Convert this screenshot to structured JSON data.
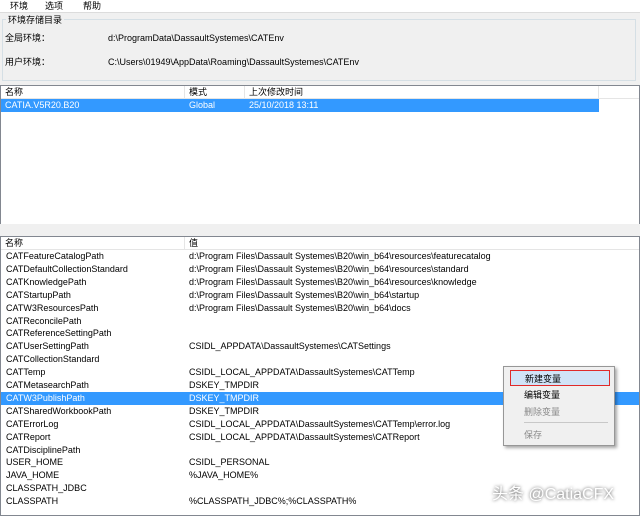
{
  "menubar": {
    "items": [
      "环境",
      "选项",
      "帮助"
    ]
  },
  "env_dir": {
    "title": "环境存储目录",
    "global_label": "全局环境：",
    "global_path": "d:\\ProgramData\\DassaultSystemes\\CATEnv",
    "user_label": "用户环境：",
    "user_path": "C:\\Users\\01949\\AppData\\Roaming\\DassaultSystemes\\CATEnv"
  },
  "env_table": {
    "headers": [
      "名称",
      "模式",
      "上次修改时间"
    ],
    "rows": [
      {
        "name": "CATIA.V5R20.B20",
        "mode": "Global",
        "modified": "25/10/2018  13:11"
      }
    ]
  },
  "var_table": {
    "headers": [
      "名称",
      "值"
    ],
    "rows": [
      {
        "name": "CATFeatureCatalogPath",
        "value": "d:\\Program Files\\Dassault Systemes\\B20\\win_b64\\resources\\featurecatalog"
      },
      {
        "name": "CATDefaultCollectionStandard",
        "value": "d:\\Program Files\\Dassault Systemes\\B20\\win_b64\\resources\\standard"
      },
      {
        "name": "CATKnowledgePath",
        "value": "d:\\Program Files\\Dassault Systemes\\B20\\win_b64\\resources\\knowledge"
      },
      {
        "name": "CATStartupPath",
        "value": "d:\\Program Files\\Dassault Systemes\\B20\\win_b64\\startup"
      },
      {
        "name": "CATW3ResourcesPath",
        "value": "d:\\Program Files\\Dassault Systemes\\B20\\win_b64\\docs"
      },
      {
        "name": "CATReconcilePath",
        "value": ""
      },
      {
        "name": "CATReferenceSettingPath",
        "value": ""
      },
      {
        "name": "CATUserSettingPath",
        "value": "CSIDL_APPDATA\\DassaultSystemes\\CATSettings"
      },
      {
        "name": "CATCollectionStandard",
        "value": ""
      },
      {
        "name": "CATTemp",
        "value": "CSIDL_LOCAL_APPDATA\\DassaultSystemes\\CATTemp"
      },
      {
        "name": "CATMetasearchPath",
        "value": "DSKEY_TMPDIR"
      },
      {
        "name": "CATW3PublishPath",
        "value": "DSKEY_TMPDIR"
      },
      {
        "name": "CATSharedWorkbookPath",
        "value": "DSKEY_TMPDIR"
      },
      {
        "name": "CATErrorLog",
        "value": "CSIDL_LOCAL_APPDATA\\DassaultSystemes\\CATTemp\\error.log"
      },
      {
        "name": "CATReport",
        "value": "CSIDL_LOCAL_APPDATA\\DassaultSystemes\\CATReport"
      },
      {
        "name": "CATDisciplinePath",
        "value": ""
      },
      {
        "name": "USER_HOME",
        "value": "CSIDL_PERSONAL"
      },
      {
        "name": "JAVA_HOME",
        "value": "%JAVA_HOME%"
      },
      {
        "name": "CLASSPATH_JDBC",
        "value": ""
      },
      {
        "name": "CLASSPATH",
        "value": "%CLASSPATH_JDBC%;%CLASSPATH%"
      }
    ],
    "selected_index": 11
  },
  "context_menu": {
    "items": [
      "新建变量",
      "编辑变量",
      "删除变量",
      "保存"
    ]
  },
  "watermark": "头条 @CatiaCFX"
}
